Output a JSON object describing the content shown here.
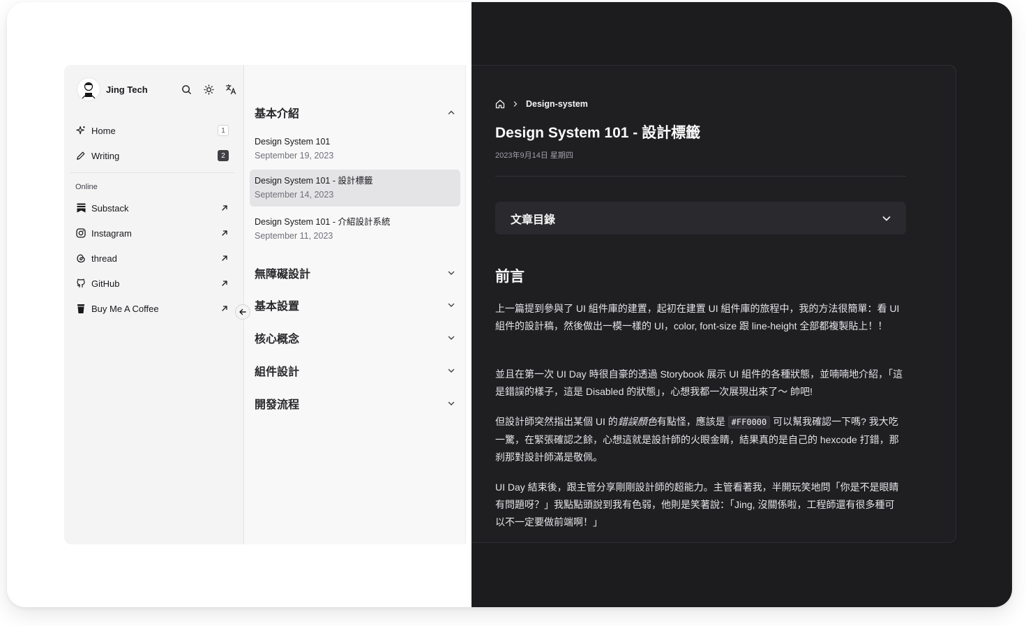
{
  "brand": {
    "name": "Jing Tech"
  },
  "top_icons": [
    "search-icon",
    "sun-icon",
    "translate-icon"
  ],
  "nav": [
    {
      "label": "Home",
      "icon": "sparkle-icon",
      "count": "1",
      "active_count": false
    },
    {
      "label": "Writing",
      "icon": "pen-icon",
      "count": "2",
      "active_count": true
    }
  ],
  "online": {
    "label": "Online",
    "links": [
      {
        "label": "Substack",
        "icon": "substack-icon"
      },
      {
        "label": "Instagram",
        "icon": "instagram-icon"
      },
      {
        "label": "thread",
        "icon": "threads-icon"
      },
      {
        "label": "GitHub",
        "icon": "github-icon"
      },
      {
        "label": "Buy Me A Coffee",
        "icon": "coffee-icon"
      }
    ]
  },
  "groups": [
    {
      "title": "基本介紹",
      "expanded": true
    },
    {
      "title": "無障礙設計",
      "expanded": false
    },
    {
      "title": "基本設置",
      "expanded": false
    },
    {
      "title": "核心概念",
      "expanded": false
    },
    {
      "title": "組件設計",
      "expanded": false
    },
    {
      "title": "開發流程",
      "expanded": false
    }
  ],
  "posts": [
    {
      "title": "Design System 101",
      "date": "September 19, 2023",
      "active": false
    },
    {
      "title": "Design System 101 - 設計標籤",
      "date": "September 14, 2023",
      "active": true
    },
    {
      "title": "Design System 101 - 介紹設計系統",
      "date": "September 11, 2023",
      "active": false
    }
  ],
  "article": {
    "breadcrumb": "Design-system",
    "title": "Design System 101 - 設計標籤",
    "date": "2023年9月14日 星期四",
    "toc_label": "文章目錄",
    "section_heading": "前言",
    "p1": "上一篇提到參與了 UI 組件庫的建置，起初在建置 UI 組件庫的旅程中，我的方法很簡單：看 UI 組件的設計稿，然後做出一模一樣的 UI，color, font-size 跟 line-height 全部都複製貼上！！",
    "p2": "並且在第一次 UI Day 時很自豪的透過 Storybook 展示 UI 組件的各種狀態，並喃喃地介紹，「這是錯誤的樣子，這是 Disabled 的狀態」，心想我都一次展現出來了～ 帥吧!",
    "p3_a": "但設計師突然指出某個 UI 的",
    "p3_em": "錯誤顏色",
    "p3_b": "有點怪，應該是 ",
    "p3_code": "#FF0000",
    "p3_c": " 可以幫我確認一下嗎? 我大吃一驚，在緊張確認之餘，心想這就是設計師的火眼金睛，結果真的是自己的 hexcode 打錯，那刹那對設計師滿是敬佩。",
    "p4": "UI Day 結束後，跟主管分享剛剛設計師的超能力。主管看著我，半開玩笑地問「你是不是眼睛有問題呀？」我點點頭說到我有色弱，他則是笑著說：「Jing, 沒關係啦，工程師還有很多種可以不一定要做前端啊！」"
  }
}
